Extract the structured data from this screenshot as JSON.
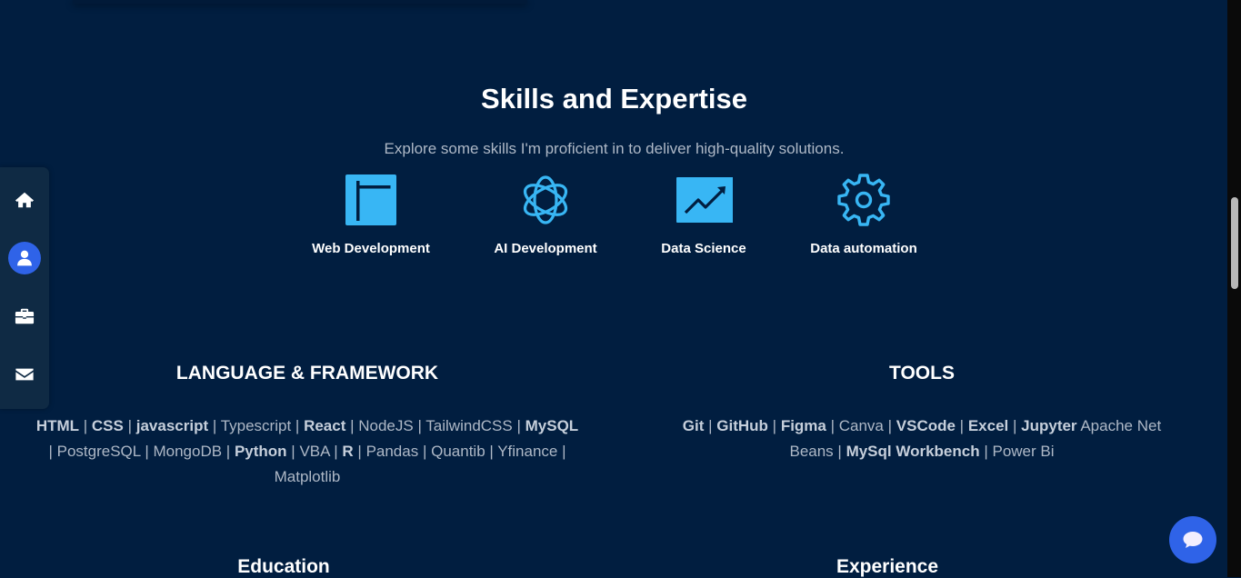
{
  "sidebar": {
    "items": [
      {
        "icon": "home-icon"
      },
      {
        "icon": "user-icon",
        "active": true
      },
      {
        "icon": "briefcase-icon"
      },
      {
        "icon": "envelope-icon"
      }
    ]
  },
  "skills_section": {
    "title": "Skills and Expertise",
    "subtitle": "Explore some skills I'm proficient in to deliver high-quality solutions.",
    "cards": [
      {
        "icon": "layout-panel-icon",
        "label": "Web Development"
      },
      {
        "icon": "openai-knot-icon",
        "label": "AI Development"
      },
      {
        "icon": "chart-line-icon",
        "label": "Data Science"
      },
      {
        "icon": "gear-icon",
        "label": "Data automation"
      }
    ]
  },
  "languages": {
    "title": "LANGUAGE & FRAMEWORK",
    "items": [
      {
        "text": "HTML",
        "bold": true
      },
      {
        "text": "CSS",
        "bold": true
      },
      {
        "text": "javascript",
        "bold": true
      },
      {
        "text": "Typescript",
        "bold": false
      },
      {
        "text": "React",
        "bold": true
      },
      {
        "text": "NodeJS",
        "bold": false
      },
      {
        "text": "TailwindCSS",
        "bold": false
      },
      {
        "text": "MySQL",
        "bold": true
      },
      {
        "text": "PostgreSQL",
        "bold": false
      },
      {
        "text": "MongoDB",
        "bold": false
      },
      {
        "text": "Python",
        "bold": true
      },
      {
        "text": "VBA",
        "bold": false
      },
      {
        "text": "R",
        "bold": true
      },
      {
        "text": "Pandas",
        "bold": false
      },
      {
        "text": "Quantib",
        "bold": false
      },
      {
        "text": "Yfinance",
        "bold": false
      },
      {
        "text": "Matplotlib",
        "bold": false
      }
    ],
    "separator": " | "
  },
  "tools": {
    "title": "TOOLS",
    "items": [
      {
        "text": "Git",
        "bold": true
      },
      {
        "text": "GitHub",
        "bold": true
      },
      {
        "text": "Figma",
        "bold": true
      },
      {
        "text": "Canva",
        "bold": false
      },
      {
        "text": "VSCode",
        "bold": true
      },
      {
        "text": "Excel",
        "bold": true
      },
      {
        "text": "Jupyter",
        "bold": true,
        "tail": " Apache Net Beans"
      },
      {
        "text": "MySql Workbench",
        "bold": true
      },
      {
        "text": "Power Bi",
        "bold": false
      }
    ],
    "separator": " | "
  },
  "bottom": {
    "education_title": "Education",
    "experience_title": "Experience"
  },
  "chat": {
    "icon": "chat-bubble-icon"
  },
  "colors": {
    "background": "#011e40",
    "accent": "#2f63e8",
    "icon_blue": "#38b6f4"
  }
}
